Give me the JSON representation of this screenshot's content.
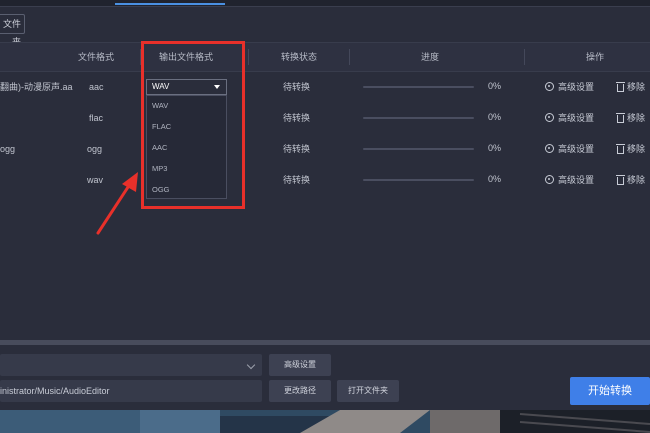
{
  "toolbar": {
    "folder_button_label": "文件夹"
  },
  "table": {
    "headers": {
      "format": "文件格式",
      "output_format": "输出文件格式",
      "status": "转换状态",
      "progress": "进度",
      "actions": "操作"
    },
    "rows": [
      {
        "name": "翻曲)-动漫原声.aa",
        "format": "aac",
        "status": "待转换",
        "progress": 0,
        "percent": "0%",
        "advanced": "高级设置",
        "remove": "移除"
      },
      {
        "name": "",
        "format": "flac",
        "status": "待转换",
        "progress": 0,
        "percent": "0%",
        "advanced": "高级设置",
        "remove": "移除"
      },
      {
        "name": "ogg",
        "format": "ogg",
        "status": "待转换",
        "progress": 0,
        "percent": "0%",
        "advanced": "高级设置",
        "remove": "移除"
      },
      {
        "name": "",
        "format": "wav",
        "status": "待转换",
        "progress": 0,
        "percent": "0%",
        "advanced": "高级设置",
        "remove": "移除"
      }
    ]
  },
  "format_select": {
    "selected": "WAV",
    "options": [
      "WAV",
      "FLAC",
      "AAC",
      "MP3",
      "OGG"
    ]
  },
  "bottom": {
    "format_dropdown_value": "",
    "advanced_button": "高级设置",
    "output_path": "inistrator/Music/AudioEditor",
    "change_path_button": "更改路径",
    "open_folder_button": "打开文件夹",
    "start_button": "开始转换"
  },
  "colors": {
    "accent": "#3f7fe8",
    "highlight": "#e8302a",
    "background": "#2a2d3b"
  }
}
